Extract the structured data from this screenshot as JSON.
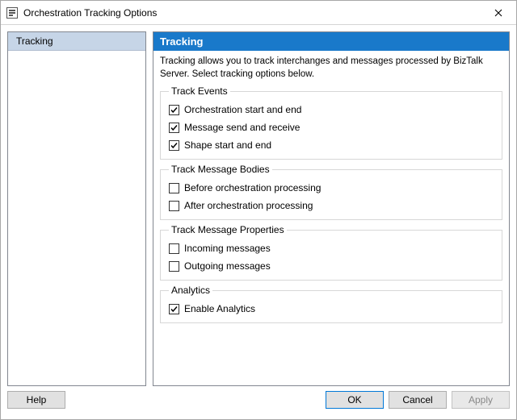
{
  "window": {
    "title": "Orchestration Tracking Options"
  },
  "nav": {
    "items": [
      "Tracking"
    ]
  },
  "panel": {
    "header": "Tracking",
    "description": "Tracking allows you to track interchanges and messages processed by BizTalk Server. Select tracking options below."
  },
  "groups": {
    "events": {
      "legend": "Track Events",
      "opt1_label": "Orchestration start and end",
      "opt1_checked": true,
      "opt2_label": "Message send and receive",
      "opt2_checked": true,
      "opt3_label": "Shape start and end",
      "opt3_checked": true
    },
    "bodies": {
      "legend": "Track Message Bodies",
      "opt1_label": "Before orchestration processing",
      "opt1_checked": false,
      "opt2_label": "After orchestration processing",
      "opt2_checked": false
    },
    "props": {
      "legend": "Track Message Properties",
      "opt1_label": "Incoming messages",
      "opt1_checked": false,
      "opt2_label": "Outgoing messages",
      "opt2_checked": false
    },
    "analytics": {
      "legend": "Analytics",
      "opt1_label": "Enable Analytics",
      "opt1_checked": true
    }
  },
  "buttons": {
    "help": "Help",
    "ok": "OK",
    "cancel": "Cancel",
    "apply": "Apply"
  }
}
